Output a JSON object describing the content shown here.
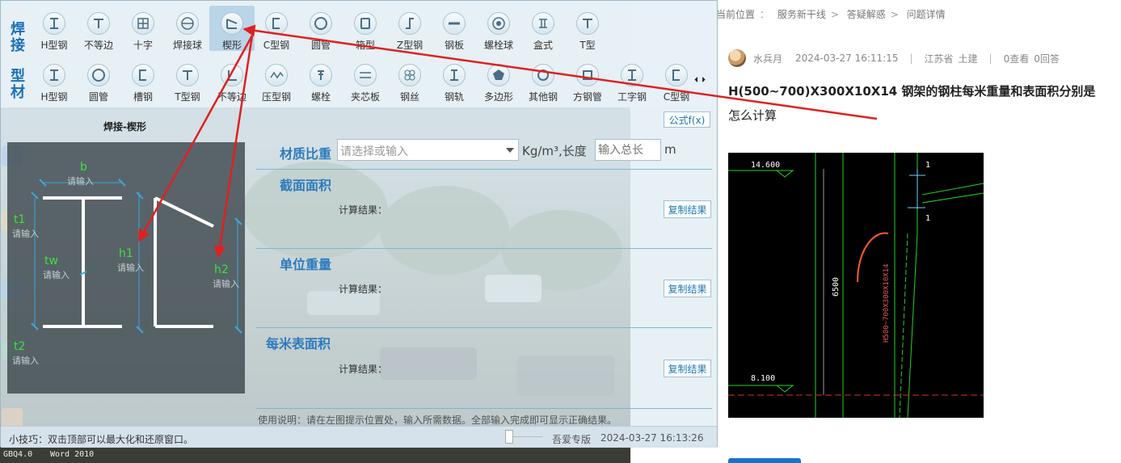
{
  "desktop": {
    "taskbar_items": [
      "GBQ4.0",
      "Word 2010"
    ]
  },
  "article": {
    "breadcrumb": [
      "当前位置",
      "服务新干线",
      "答疑解惑",
      "问题详情"
    ],
    "author": "水兵月",
    "post_time": "2024-03-27 16:11:15",
    "region": "江苏省",
    "specialty": "土建",
    "views": "0查看",
    "answers": "0回答",
    "title_line1": "H(500~700)X300X10X14 钢架的钢柱每米重量和表面积分别是",
    "title_line2": "怎么计算",
    "cad": {
      "elev_top": "14.600",
      "elev_bottom": "8.100",
      "dim": "6500",
      "member": "H500~700X300X10X14",
      "mark1": "1",
      "mark2": "1"
    }
  },
  "calc": {
    "categories": {
      "weld": "焊接",
      "profile": "型材"
    },
    "row1": [
      {
        "label": "H型钢",
        "icon": "h-beam-icon"
      },
      {
        "label": "不等边",
        "icon": "t-section-icon"
      },
      {
        "label": "十字",
        "icon": "cross-icon"
      },
      {
        "label": "焊接球",
        "icon": "weld-ball-icon"
      },
      {
        "label": "楔形",
        "icon": "wedge-icon"
      },
      {
        "label": "C型钢",
        "icon": "c-channel-icon"
      },
      {
        "label": "圆管",
        "icon": "round-tube-icon"
      },
      {
        "label": "箱型",
        "icon": "box-section-icon"
      },
      {
        "label": "Z型钢",
        "icon": "z-section-icon"
      },
      {
        "label": "钢板",
        "icon": "plate-icon"
      },
      {
        "label": "螺栓球",
        "icon": "bolt-ball-icon"
      },
      {
        "label": "盒式",
        "icon": "box-type-icon"
      },
      {
        "label": "T型",
        "icon": "t-beam-icon"
      }
    ],
    "row2": [
      {
        "label": "H型钢",
        "icon": "h-beam-icon"
      },
      {
        "label": "圆管",
        "icon": "round-tube-icon"
      },
      {
        "label": "槽钢",
        "icon": "channel-icon"
      },
      {
        "label": "T型钢",
        "icon": "t-beam-icon"
      },
      {
        "label": "不等边",
        "icon": "angle-icon"
      },
      {
        "label": "压型钢",
        "icon": "deck-icon"
      },
      {
        "label": "螺栓",
        "icon": "bolt-icon"
      },
      {
        "label": "夹芯板",
        "icon": "sandwich-icon"
      },
      {
        "label": "钢丝",
        "icon": "wire-icon"
      },
      {
        "label": "钢轨",
        "icon": "rail-icon"
      },
      {
        "label": "多边形",
        "icon": "polygon-icon"
      },
      {
        "label": "其他钢",
        "icon": "other-steel-icon"
      },
      {
        "label": "方钢管",
        "icon": "square-tube-icon"
      },
      {
        "label": "工字钢",
        "icon": "i-beam-icon"
      },
      {
        "label": "C型钢",
        "icon": "c-channel-icon"
      }
    ],
    "active_tool": "楔形",
    "section_title": "焊接-楔形",
    "formula_button": "公式f(x)",
    "params": {
      "b": "b",
      "t1": "t1",
      "tw": "tw",
      "h1": "h1",
      "h2": "h2",
      "t2": "t2",
      "hint": "请输入"
    },
    "material_label": "材质比重",
    "material_placeholder": "请选择或输入",
    "unit_text": "Kg/m³,长度",
    "length_placeholder": "输入总长",
    "length_unit": "m",
    "area_label": "截面面积",
    "unit_weight_label": "单位重量",
    "surface_label": "每米表面积",
    "result_label": "计算结果：",
    "copy_button": "复制结果",
    "usage_note": "使用说明：请在左图提示位置处，输入所需数据。全部输入完成即可显示正确结果。",
    "tip": "小技巧：双击顶部可以最大化和还原窗口。",
    "edition": "吾爱专版",
    "clock": "2024-03-27 16:13:26"
  },
  "colors": {
    "accent_blue": "#2d7bbd",
    "annotation_red": "#e02020",
    "param_green": "#3ee03e",
    "cad_green": "#25d325"
  }
}
